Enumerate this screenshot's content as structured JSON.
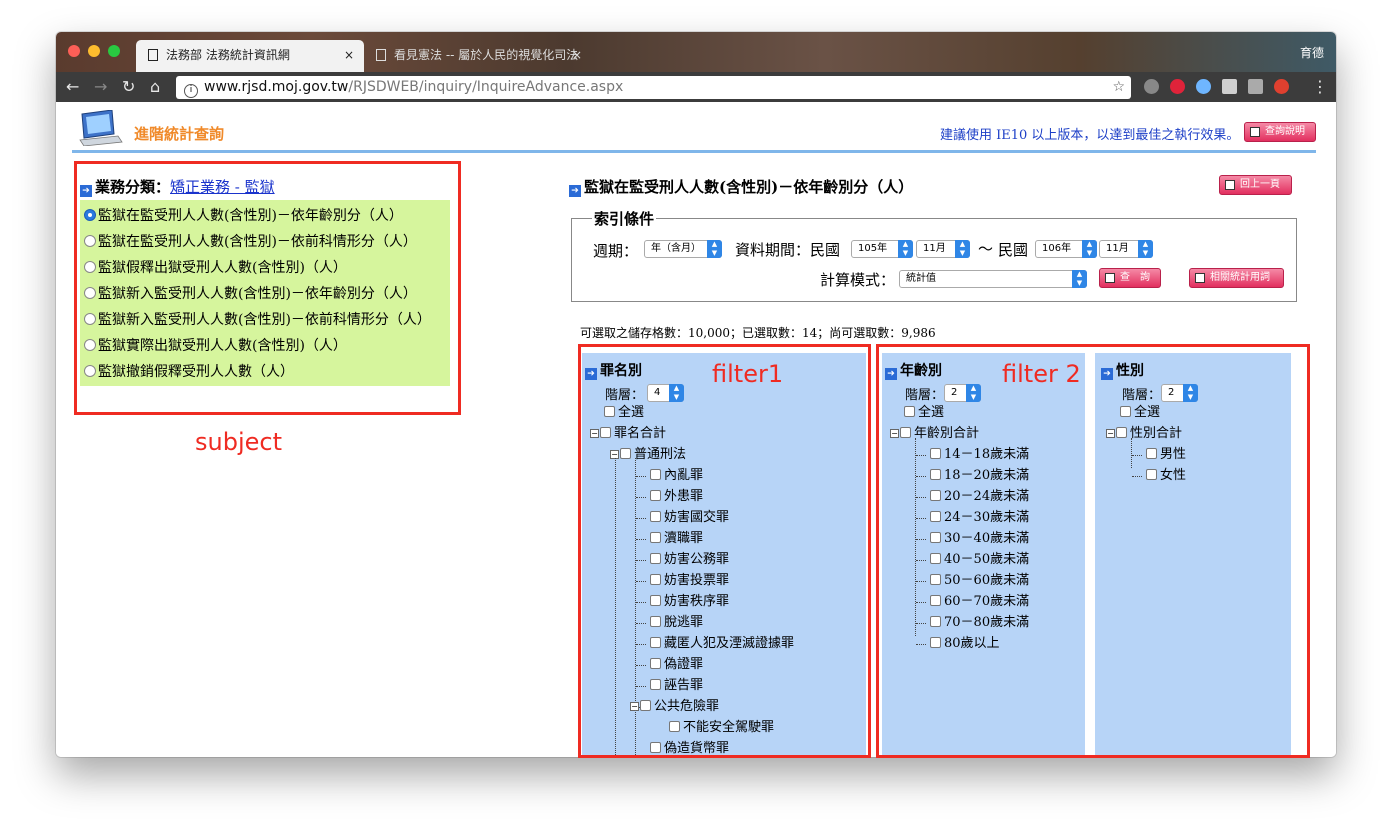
{
  "browser": {
    "tabs": [
      {
        "title": "法務部 法務統計資訊網",
        "close": "×"
      },
      {
        "title": "看見憲法 -- 屬於人民的視覺化司法",
        "close": "×"
      }
    ],
    "profile": "育德",
    "url_host": "www.rjsd.moj.gov.tw",
    "url_path": "/RJSDWEB/inquiry/InquireAdvance.aspx"
  },
  "header": {
    "site_title": "進階統計查詢",
    "browser_note": "建議使用 IE10 以上版本，以達到最佳之執行效果。",
    "help_button": "查詢說明"
  },
  "subject": {
    "label": "業務分類：",
    "link": "矯正業務 - 監獄",
    "options": [
      "監獄在監受刑人人數(含性別)－依年齡別分（人）",
      "監獄在監受刑人人數(含性別)－依前科情形分（人）",
      "監獄假釋出獄受刑人人數(含性別)（人）",
      "監獄新入監受刑人人數(含性別)－依年齡別分（人）",
      "監獄新入監受刑人人數(含性別)－依前科情形分（人）",
      "監獄實際出獄受刑人人數(含性別)（人）",
      "監獄撤銷假釋受刑人人數（人）"
    ],
    "selected_index": 0
  },
  "main": {
    "title": "監獄在監受刑人人數(含性別)－依年齡別分（人）",
    "back_button": "回上一頁",
    "index_legend": "索引條件",
    "period_label": "週期：",
    "period_value": "年（含月）",
    "range_label": "資料期間：民國",
    "from_year": "105年",
    "from_month": "11月",
    "range_sep": "～",
    "to_label": "民國",
    "to_year": "106年",
    "to_month": "11月",
    "calc_label": "計算模式：",
    "calc_value": "統計值",
    "query_button": "查　詢",
    "related_button": "相關統計用詞",
    "cell_count": "可選取之儲存格數：10,000；已選取數：14；尚可選取數：9,986"
  },
  "filters": {
    "crime": {
      "title": "罪名別",
      "level_label": "階層：",
      "level_value": "4",
      "select_all": "全選",
      "root": "罪名合計",
      "group": "普通刑法",
      "items": [
        "內亂罪",
        "外患罪",
        "妨害國交罪",
        "瀆職罪",
        "妨害公務罪",
        "妨害投票罪",
        "妨害秩序罪",
        "脫逃罪",
        "藏匿人犯及湮滅證據罪",
        "偽證罪",
        "誣告罪",
        "公共危險罪"
      ],
      "sub_item": "不能安全駕駛罪",
      "last_item": "偽造貨幣罪"
    },
    "age": {
      "title": "年齡別",
      "level_label": "階層：",
      "level_value": "2",
      "select_all": "全選",
      "root": "年齡別合計",
      "items": [
        "14－18歲未滿",
        "18－20歲未滿",
        "20－24歲未滿",
        "24－30歲未滿",
        "30－40歲未滿",
        "40－50歲未滿",
        "50－60歲未滿",
        "60－70歲未滿",
        "70－80歲未滿",
        "80歲以上"
      ]
    },
    "sex": {
      "title": "性別",
      "level_label": "階層：",
      "level_value": "2",
      "select_all": "全選",
      "root": "性別合計",
      "items": [
        "男性",
        "女性"
      ]
    }
  },
  "annotations": {
    "subject": "subject",
    "filter1": "filter1",
    "filter2": "filter 2"
  },
  "colors": {
    "annotation_red": "#ef2b22",
    "subject_panel": "#d6f59d",
    "filter_panel": "#b7d4f7",
    "site_title": "#f08a2a"
  }
}
